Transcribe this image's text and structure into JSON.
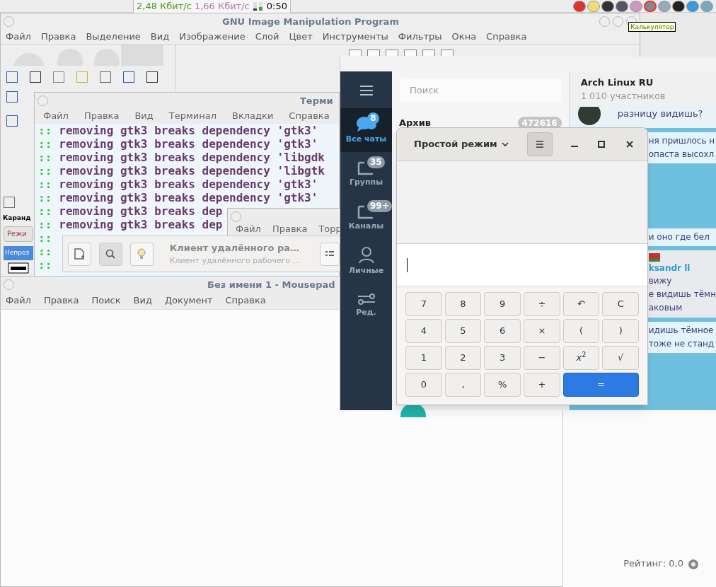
{
  "top_panel": {
    "net_down": "2,48 Кбит/с",
    "net_up": "1,66 Кбит/с",
    "clock": "0:50",
    "tooltip": "Калькулятор"
  },
  "gimp": {
    "title": "GNU Image Manipulation Program",
    "menu": [
      "Файл",
      "Правка",
      "Выделение",
      "Вид",
      "Изображение",
      "Слой",
      "Цвет",
      "Инструменты",
      "Фильтры",
      "Окна",
      "Справка"
    ],
    "tool_options": {
      "title": "Каранд",
      "mode": "Режи",
      "opacity": {
        "label": "Непроз",
        "level": 1
      }
    }
  },
  "terminal": {
    "title": "Терми",
    "menu": [
      "Файл",
      "Правка",
      "Вид",
      "Терминал",
      "Вкладки",
      "Справка"
    ],
    "lines": [
      {
        "prompt": "::",
        "text": "removing gtk3 breaks dependency 'gtk3'"
      },
      {
        "prompt": "::",
        "text": "removing gtk3 breaks dependency 'gtk3'"
      },
      {
        "prompt": "::",
        "text": "removing gtk3 breaks dependency 'libgdk"
      },
      {
        "prompt": "::",
        "text": "removing gtk3 breaks dependency 'libgtk"
      },
      {
        "prompt": "::",
        "text": "removing gtk3 breaks dependency 'gtk3'"
      },
      {
        "prompt": "::",
        "text": "removing gtk3 breaks dependency 'gtk3'"
      },
      {
        "prompt": "::",
        "text": "removing gtk3 breaks dep"
      },
      {
        "prompt": "::",
        "text": "removing gtk3 breaks dep"
      },
      {
        "prompt": "::"
      },
      {
        "prompt": "::"
      },
      {
        "prompt": "::"
      }
    ]
  },
  "torrent": {
    "menu": [
      "Файл",
      "Правка",
      "Торр"
    ]
  },
  "remote_desktop": {
    "title": "Клиент удалённого ра…",
    "subtitle": "Клиент удалённого рабочего …"
  },
  "mousepad": {
    "title": "Без имени 1 - Mousepad",
    "menu": [
      "Файл",
      "Правка",
      "Поиск",
      "Вид",
      "Документ",
      "Справка"
    ]
  },
  "telegram": {
    "sidebar": [
      {
        "kind": "chats",
        "label": "Все чаты",
        "badge": "8",
        "selected": true
      },
      {
        "kind": "folder",
        "label": "Группы",
        "badge": "35",
        "selected": false
      },
      {
        "kind": "folder",
        "label": "Каналы",
        "badge": "99+",
        "selected": false
      },
      {
        "kind": "person",
        "label": "Личные",
        "selected": false
      },
      {
        "kind": "edit",
        "label": "Ред.",
        "selected": false
      }
    ],
    "search": {
      "placeholder": "Поиск"
    },
    "chats": [
      {
        "name": "Архив",
        "count": "472616"
      }
    ],
    "chat": {
      "title": "Arch Linux RU",
      "members": "1 010 участников",
      "messages": [
        {
          "kind": "reply",
          "lines": [
            "разницу видишь?"
          ]
        },
        {
          "kind": "text",
          "lines": [
            "ня пришлось н",
            "опаста высохл"
          ]
        },
        {
          "kind": "image"
        },
        {
          "kind": "text",
          "lines": [
            "и оно где бел"
          ]
        },
        {
          "kind": "named",
          "author": "ksandr ll",
          "lines": [
            "вижу",
            "е видишь тёмн",
            "аковым"
          ]
        },
        {
          "kind": "text",
          "lines": [
            "идишь тёмное",
            "тоже не станд"
          ]
        }
      ]
    }
  },
  "calculator": {
    "mode": "Простой режим",
    "keys": [
      {
        "label": "7",
        "kind": "key"
      },
      {
        "label": "8",
        "kind": "key"
      },
      {
        "label": "9",
        "kind": "key"
      },
      {
        "label": "÷",
        "kind": "key"
      },
      {
        "label": "↶",
        "kind": "key"
      },
      {
        "label": "C",
        "kind": "key"
      },
      {
        "label": "4",
        "kind": "key"
      },
      {
        "label": "5",
        "kind": "key"
      },
      {
        "label": "6",
        "kind": "key"
      },
      {
        "label": "×",
        "kind": "key"
      },
      {
        "label": "(",
        "kind": "key"
      },
      {
        "label": ")",
        "kind": "key"
      },
      {
        "label": "1",
        "kind": "key"
      },
      {
        "label": "2",
        "kind": "key"
      },
      {
        "label": "3",
        "kind": "key"
      },
      {
        "label": "−",
        "kind": "key"
      },
      {
        "label": "*x*$^{2}$",
        "kind": "key"
      },
      {
        "label": "√",
        "kind": "key"
      },
      {
        "label": "0",
        "kind": "key"
      },
      {
        "label": ",",
        "kind": "key"
      },
      {
        "label": "%",
        "kind": "key"
      },
      {
        "label": "+",
        "kind": "key"
      },
      {
        "label": "=",
        "kind": "equals"
      }
    ]
  },
  "rating_panel": {
    "text": "Рейтинг: 0,0"
  }
}
